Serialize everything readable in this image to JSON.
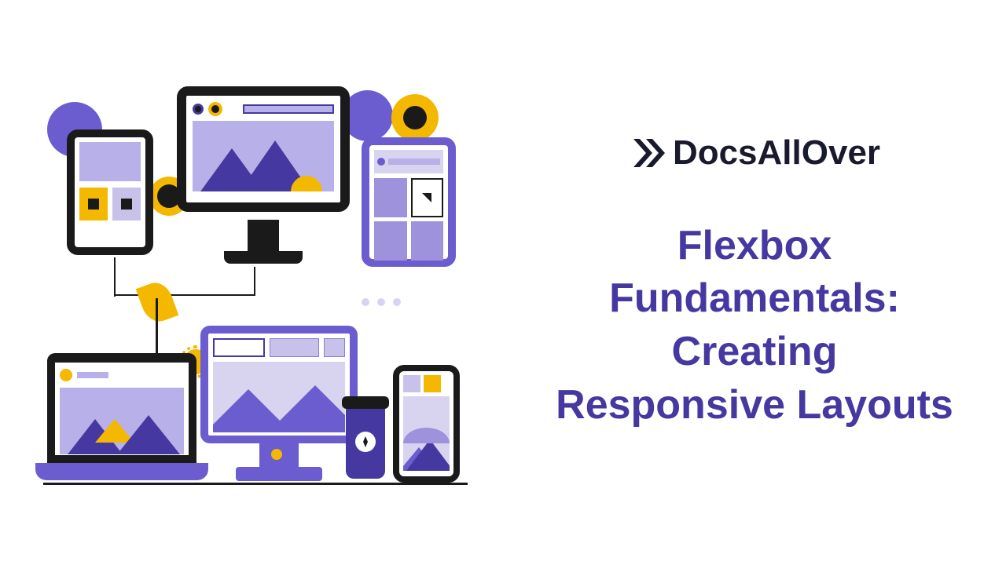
{
  "brand": {
    "name": "DocsAllOver"
  },
  "headline": {
    "line1": "Flexbox",
    "line2": "Fundamentals:",
    "line3": "Creating",
    "line4": "Responsive Layouts"
  },
  "colors": {
    "primary": "#4538a0",
    "accent": "#f5b800",
    "dark": "#1a1a1a",
    "light_purple": "#b8b0e8"
  }
}
